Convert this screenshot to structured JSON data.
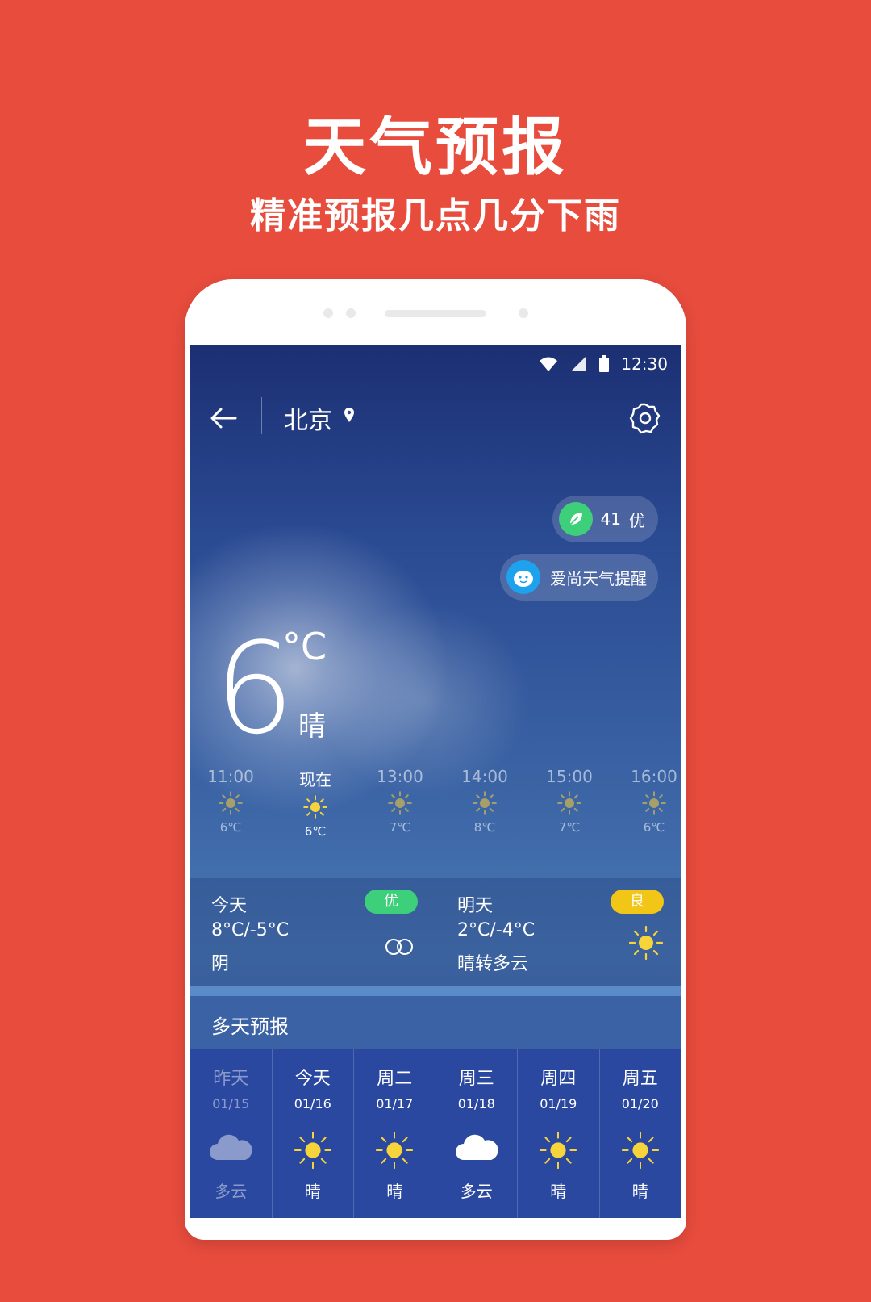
{
  "promo": {
    "title": "天气预报",
    "subtitle": "精准预报几点几分下雨"
  },
  "status": {
    "time": "12:30"
  },
  "header": {
    "city": "北京"
  },
  "aqi": {
    "value": "41",
    "level": "优"
  },
  "reminder": {
    "label": "爱尚天气提醒"
  },
  "current": {
    "temp": "6",
    "unit": "°C",
    "condition": "晴"
  },
  "hourly": [
    {
      "time": "11:00",
      "temp": "6℃",
      "icon": "sun-icon"
    },
    {
      "time": "现在",
      "temp": "6℃",
      "icon": "sun-icon",
      "now": true
    },
    {
      "time": "13:00",
      "temp": "7℃",
      "icon": "sun-icon"
    },
    {
      "time": "14:00",
      "temp": "8℃",
      "icon": "sun-icon"
    },
    {
      "time": "15:00",
      "temp": "7℃",
      "icon": "sun-icon"
    },
    {
      "time": "16:00",
      "temp": "6℃",
      "icon": "sun-icon"
    }
  ],
  "today": {
    "name": "今天",
    "range": "8°C/-5°C",
    "condition": "阴",
    "aqi": "优",
    "icon": "overcast-icon"
  },
  "tomorrow": {
    "name": "明天",
    "range": "2°C/-4°C",
    "condition": "晴转多云",
    "aqi": "良",
    "icon": "sun-icon"
  },
  "multi": {
    "title": "多天预报",
    "days": [
      {
        "name": "昨天",
        "date": "01/15",
        "cond": "多云",
        "icon": "cloud-icon"
      },
      {
        "name": "今天",
        "date": "01/16",
        "cond": "晴",
        "icon": "sun-icon"
      },
      {
        "name": "周二",
        "date": "01/17",
        "cond": "晴",
        "icon": "sun-icon"
      },
      {
        "name": "周三",
        "date": "01/18",
        "cond": "多云",
        "icon": "cloud-icon"
      },
      {
        "name": "周四",
        "date": "01/19",
        "cond": "晴",
        "icon": "sun-icon"
      },
      {
        "name": "周五",
        "date": "01/20",
        "cond": "晴",
        "icon": "sun-icon"
      }
    ]
  },
  "colors": {
    "background": "#e84c3d",
    "aqi_good": "#3ecf7a",
    "aqi_moderate": "#f2c617",
    "sun": "#f7d43a"
  }
}
